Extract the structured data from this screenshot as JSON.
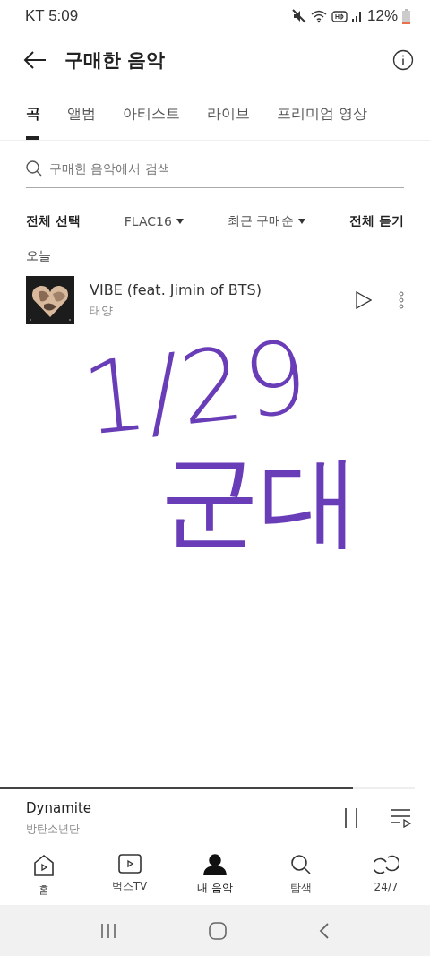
{
  "status_bar": {
    "carrier_time": "KT 5:09",
    "battery": "12%"
  },
  "header": {
    "title": "구매한 음악"
  },
  "tabs": [
    {
      "label": "곡",
      "selected": true
    },
    {
      "label": "앨범",
      "selected": false
    },
    {
      "label": "아티스트",
      "selected": false
    },
    {
      "label": "라이브",
      "selected": false
    },
    {
      "label": "프리미엄 영상",
      "selected": false
    }
  ],
  "search": {
    "placeholder": "구매한 음악에서 검색"
  },
  "filters": {
    "select_all": "전체 선택",
    "quality": "FLAC16",
    "sort": "최근 구매순",
    "play_all": "전체 듣기"
  },
  "section": "오늘",
  "songs": [
    {
      "title": "VIBE (feat. Jimin of BTS)",
      "artist": "태양"
    }
  ],
  "handwritten_note": [
    "1/29",
    "군대"
  ],
  "player": {
    "title": "Dynamite",
    "artist": "방탄소년단",
    "level": 0.85,
    "playing": true
  },
  "nav": [
    {
      "kind": "home",
      "label": "홈",
      "selected": false
    },
    {
      "kind": "tv",
      "label": "벅스TV",
      "selected": false
    },
    {
      "kind": "person",
      "label": "내 음악",
      "selected": true
    },
    {
      "kind": "search",
      "label": "탐색",
      "selected": false
    },
    {
      "kind": "loop",
      "label": "24/7",
      "selected": false
    }
  ]
}
